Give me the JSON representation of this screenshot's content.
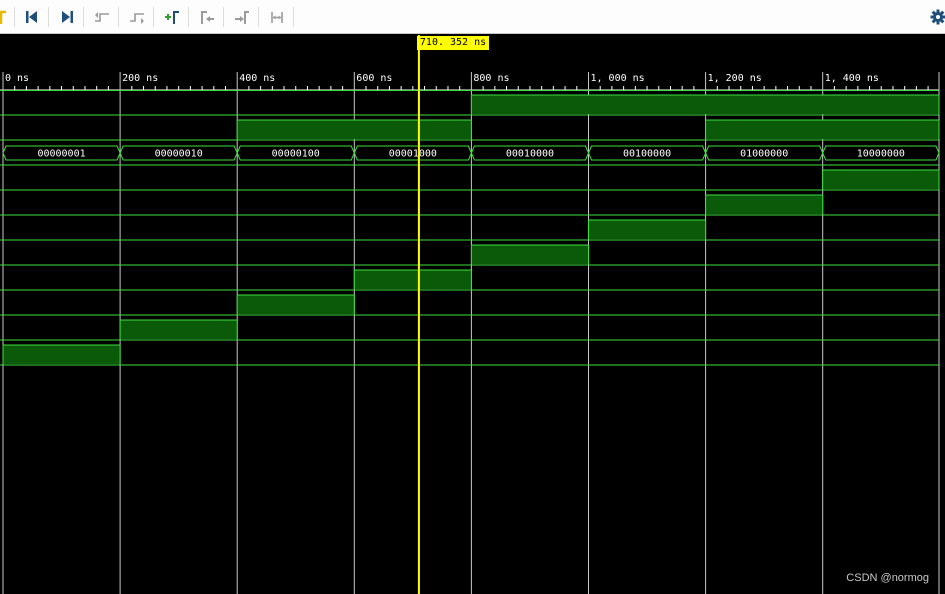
{
  "toolbar": {
    "buttons": [
      {
        "name": "zoom-fit-icon",
        "color": "#e6b800"
      },
      {
        "name": "go-to-time-0-icon",
        "color": "#1f4e79"
      },
      {
        "name": "go-to-last-time-icon",
        "color": "#1f4e79"
      },
      {
        "name": "previous-transition-icon",
        "color": "#9a9a9a"
      },
      {
        "name": "next-transition-icon",
        "color": "#9a9a9a"
      },
      {
        "name": "add-marker-icon",
        "color": "#2e9e2e"
      },
      {
        "name": "previous-marker-icon",
        "color": "#9a9a9a"
      },
      {
        "name": "next-marker-icon",
        "color": "#9a9a9a"
      },
      {
        "name": "swap-cursors-icon",
        "color": "#9a9a9a"
      }
    ],
    "settings_icon": "gear-icon"
  },
  "timeline": {
    "unit": "ns",
    "start": 0,
    "end": 1600,
    "major_step": 200,
    "minor_step": 20,
    "tick_labels": [
      "0 ns",
      "200 ns",
      "400 ns",
      "600 ns",
      "800 ns",
      "1, 000 ns",
      "1, 200 ns",
      "1, 400 ns"
    ]
  },
  "cursor": {
    "time": 710.352,
    "label": "710. 352 ns",
    "color": "#ffff00"
  },
  "colors": {
    "background": "#000000",
    "wave": "#3ce03c",
    "wave_fill": "#0a5a0a",
    "grid": "#c8c8c8"
  },
  "signals": [
    {
      "kind": "bit",
      "segments": [
        [
          0,
          800,
          0
        ],
        [
          800,
          1600,
          1
        ]
      ]
    },
    {
      "kind": "bit",
      "segments": [
        [
          0,
          400,
          0
        ],
        [
          400,
          800,
          1
        ],
        [
          800,
          1200,
          0
        ],
        [
          1200,
          1600,
          1
        ]
      ]
    },
    {
      "kind": "bus",
      "segments": [
        [
          0,
          200,
          "00000001"
        ],
        [
          200,
          400,
          "00000010"
        ],
        [
          400,
          600,
          "00000100"
        ],
        [
          600,
          800,
          "00001000"
        ],
        [
          800,
          1000,
          "00010000"
        ],
        [
          1000,
          1200,
          "00100000"
        ],
        [
          1200,
          1400,
          "01000000"
        ],
        [
          1400,
          1600,
          "10000000"
        ]
      ]
    },
    {
      "kind": "bit",
      "segments": [
        [
          0,
          1400,
          0
        ],
        [
          1400,
          1600,
          1
        ]
      ]
    },
    {
      "kind": "bit",
      "segments": [
        [
          0,
          1200,
          0
        ],
        [
          1200,
          1400,
          1
        ],
        [
          1400,
          1600,
          0
        ]
      ]
    },
    {
      "kind": "bit",
      "segments": [
        [
          0,
          1000,
          0
        ],
        [
          1000,
          1200,
          1
        ],
        [
          1200,
          1600,
          0
        ]
      ]
    },
    {
      "kind": "bit",
      "segments": [
        [
          0,
          800,
          0
        ],
        [
          800,
          1000,
          1
        ],
        [
          1000,
          1600,
          0
        ]
      ]
    },
    {
      "kind": "bit",
      "segments": [
        [
          0,
          600,
          0
        ],
        [
          600,
          800,
          1
        ],
        [
          800,
          1600,
          0
        ]
      ]
    },
    {
      "kind": "bit",
      "segments": [
        [
          0,
          400,
          0
        ],
        [
          400,
          600,
          1
        ],
        [
          600,
          1600,
          0
        ]
      ]
    },
    {
      "kind": "bit",
      "segments": [
        [
          0,
          200,
          0
        ],
        [
          200,
          400,
          1
        ],
        [
          400,
          1600,
          0
        ]
      ]
    },
    {
      "kind": "bit",
      "segments": [
        [
          0,
          200,
          1
        ],
        [
          200,
          1600,
          0
        ]
      ]
    }
  ],
  "watermark": "CSDN @normog"
}
